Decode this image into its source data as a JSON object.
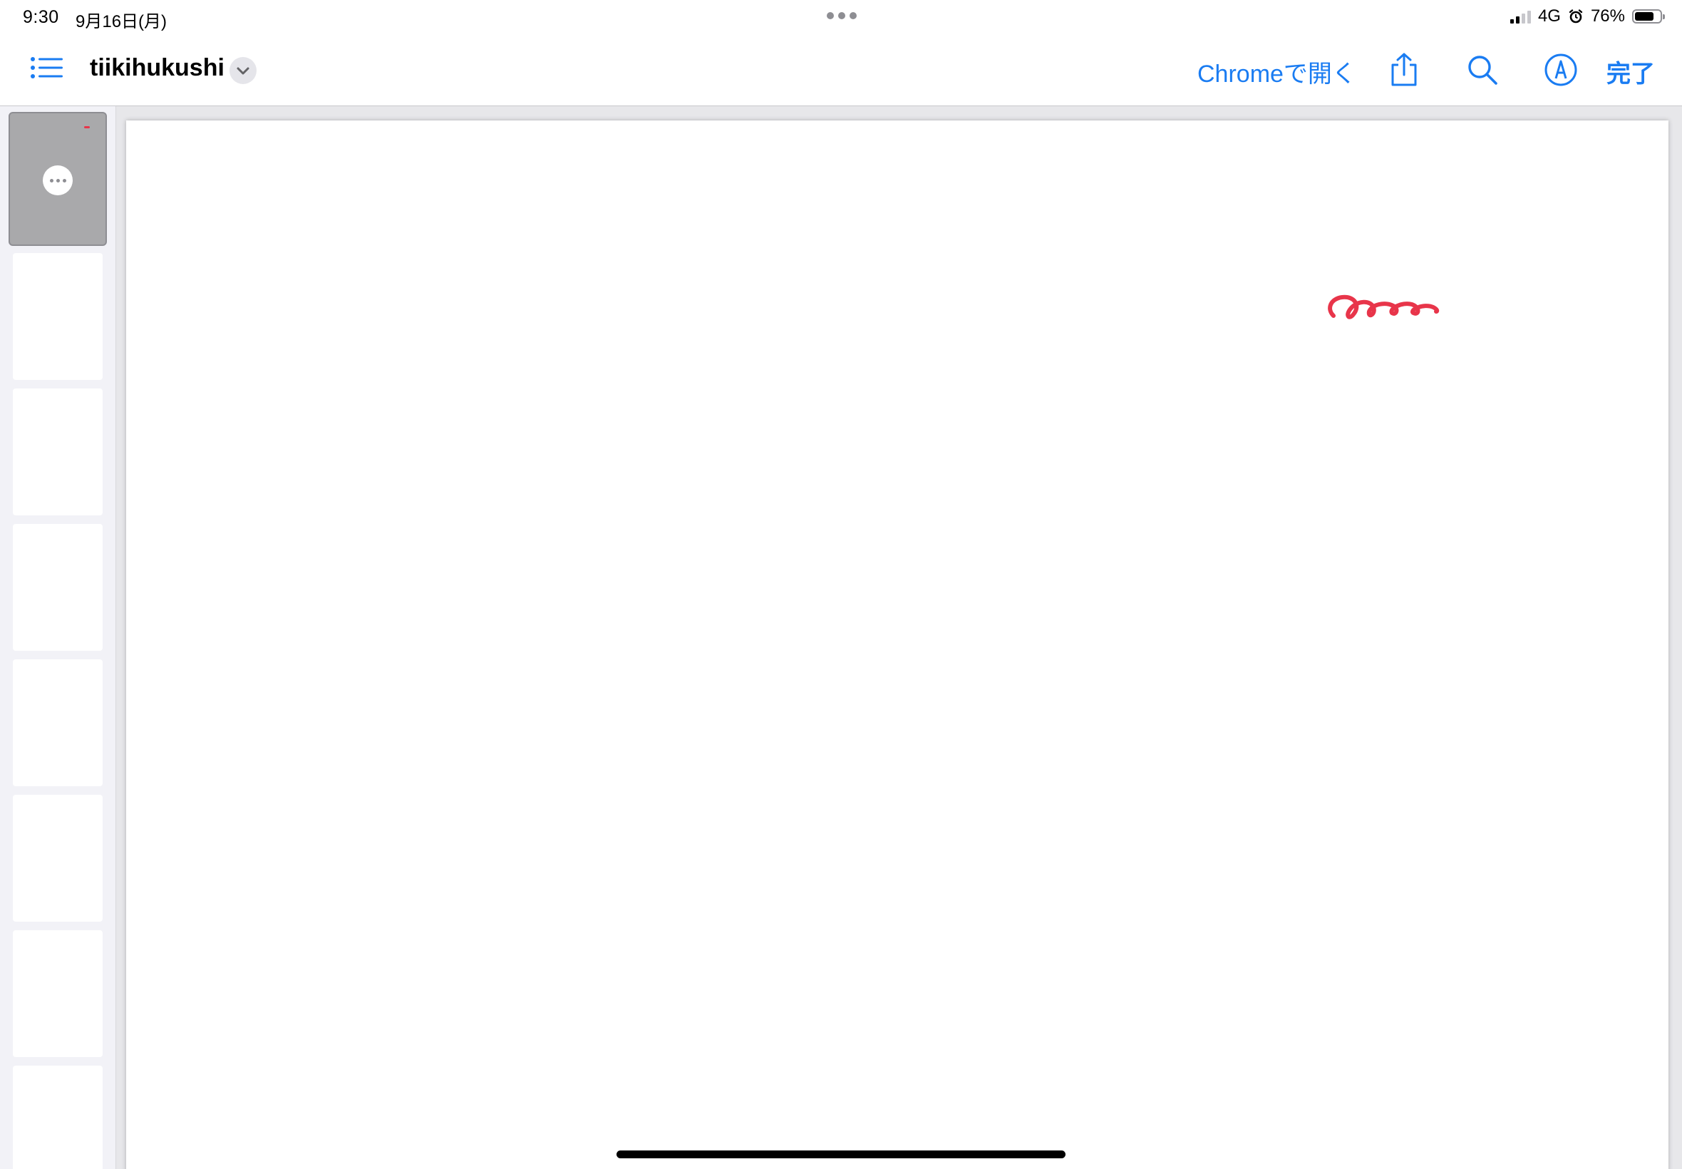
{
  "status_bar": {
    "time": "9:30",
    "date": "9月16日(月)",
    "network": "4G",
    "battery_percent": "76%",
    "battery_level": 0.76,
    "signal_bars": 2,
    "icons": {
      "multitask": "ellipsis-icon",
      "signal": "cellular-signal-icon",
      "alarm": "alarm-clock-icon",
      "battery": "battery-icon"
    }
  },
  "toolbar": {
    "title": "tiikihukushi",
    "open_in_label": "Chromeで開く",
    "done_label": "完了",
    "icons": {
      "list": "list-icon",
      "title_menu": "chevron-down-icon",
      "share": "share-icon",
      "search": "search-icon",
      "markup": "markup-pen-icon"
    },
    "accent_color": "#1a7cf2"
  },
  "sidebar": {
    "thumbnail_count": 8,
    "selected_index": 0,
    "more_icon": "more-ellipsis-icon"
  },
  "document": {
    "annotation_color": "#e8354a",
    "annotation": "red-handwritten-scribble"
  }
}
